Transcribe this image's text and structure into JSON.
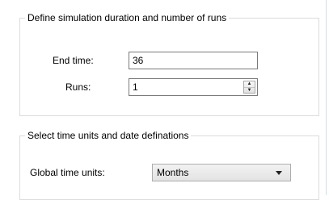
{
  "simulation": {
    "title": "Define simulation duration and number of runs",
    "end_time_label": "End time:",
    "end_time_value": "36",
    "runs_label": "Runs:",
    "runs_value": "1"
  },
  "time_units": {
    "title": "Select time units and date definations",
    "global_units_label": "Global time units:",
    "global_units_value": "Months"
  },
  "icons": {
    "spin_up": "spin-up-icon",
    "spin_down": "spin-down-icon",
    "dropdown": "dropdown-arrow-icon"
  }
}
